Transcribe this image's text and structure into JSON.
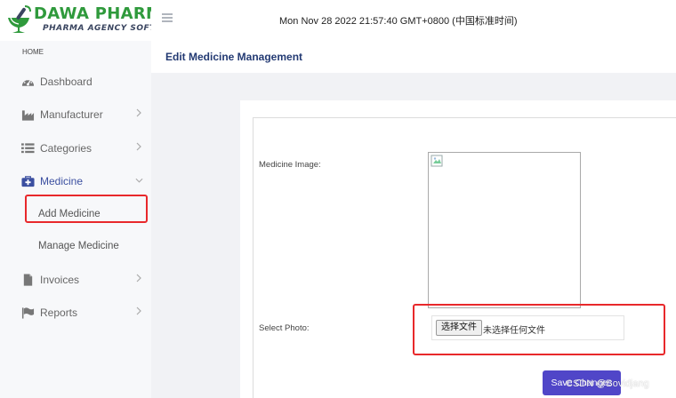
{
  "brand": {
    "title": "DAWA PHARMA",
    "subtitle": "PHARMA AGENCY SOFTWARE",
    "colors": {
      "green": "#2f9a3c",
      "navy": "#3a4560"
    }
  },
  "topbar": {
    "datetime": "Mon Nov 28 2022 21:57:40 GMT+0800 (中国标准时间)",
    "menu_icon": "hamburger-icon"
  },
  "sidebar": {
    "section_label": "HOME",
    "items": [
      {
        "label": "Dashboard",
        "icon": "tachometer-icon",
        "has_submenu": false
      },
      {
        "label": "Manufacturer",
        "icon": "industry-icon",
        "has_submenu": true
      },
      {
        "label": "Categories",
        "icon": "list-icon",
        "has_submenu": true
      },
      {
        "label": "Medicine",
        "icon": "medkit-icon",
        "has_submenu": true,
        "expanded": true,
        "active": true
      },
      {
        "label": "Invoices",
        "icon": "file-icon",
        "has_submenu": true
      },
      {
        "label": "Reports",
        "icon": "flag-icon",
        "has_submenu": true
      }
    ],
    "medicine_submenu": [
      {
        "label": "Add Medicine"
      },
      {
        "label": "Manage Medicine",
        "highlighted": true
      }
    ]
  },
  "page": {
    "title": "Edit Medicine Management"
  },
  "form": {
    "image_label": "Medicine Image:",
    "photo_label": "Select Photo:",
    "file_button": "选择文件",
    "file_status": "未选择任何文件",
    "save_button": "Save Changes"
  },
  "watermark": "CSDN @Bovidjang",
  "colors": {
    "accent": "#5046c8",
    "highlight": "#e8282b",
    "title": "#233a73",
    "active_nav": "#3b4fa0"
  }
}
